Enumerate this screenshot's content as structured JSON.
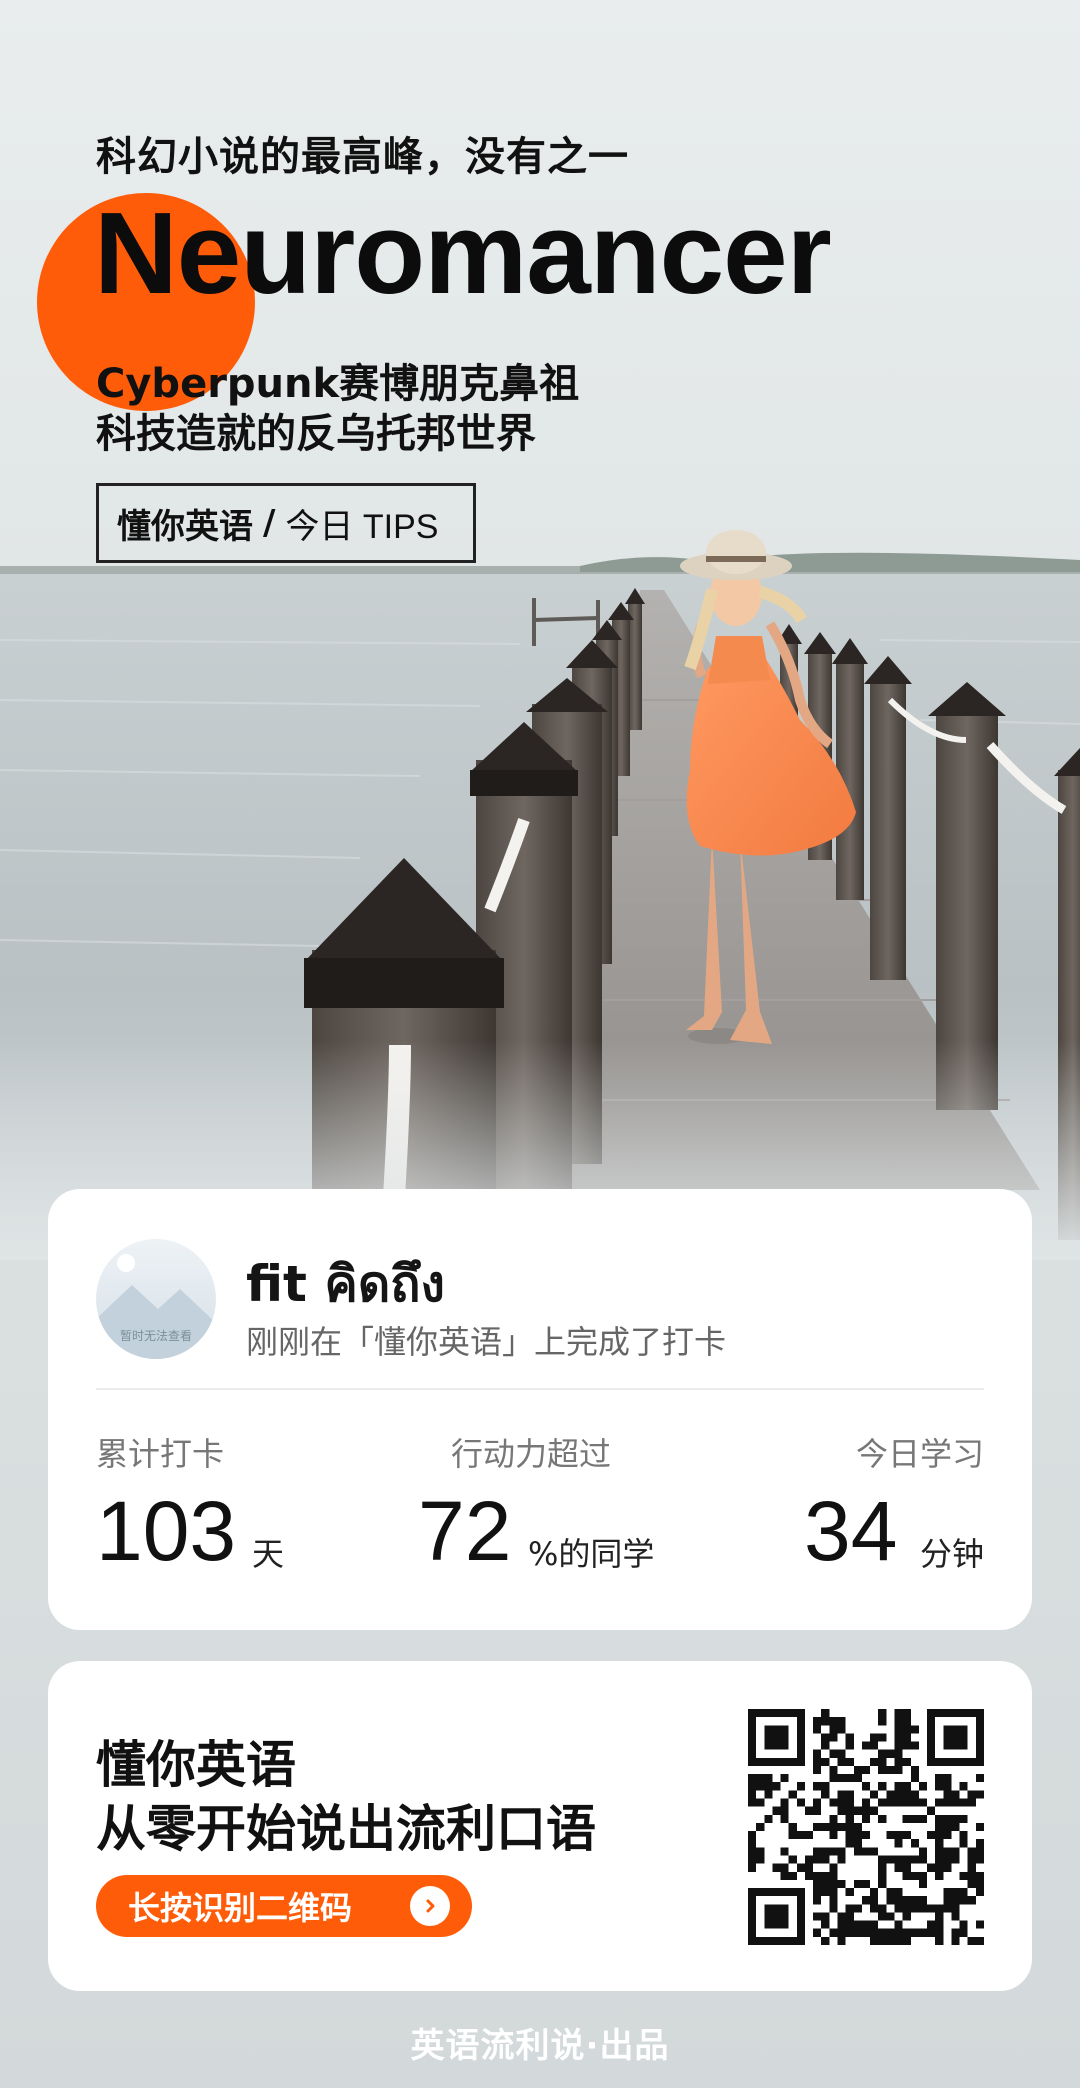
{
  "header": {
    "tagline": "科幻小说的最高峰，没有之一",
    "book_title": "Neuromancer",
    "subtitle_line1": "Cyberpunk赛博朋克鼻祖",
    "subtitle_line2": "科技造就的反乌托邦世界",
    "brand_name": "懂你英语",
    "brand_separator": "/",
    "brand_tips": "今日 TIPS"
  },
  "checkin_card": {
    "avatar_caption": "暂时无法查看",
    "username": "fit คิดถึง",
    "message": "刚刚在「懂你英语」上完成了打卡",
    "stats": [
      {
        "label": "累计打卡",
        "value": "103",
        "unit": "天"
      },
      {
        "label": "行动力超过",
        "value": "72",
        "unit": "%的同学"
      },
      {
        "label": "今日学习",
        "value": "34",
        "unit": "分钟"
      }
    ]
  },
  "promo_card": {
    "line1": "懂你英语",
    "line2": "从零开始说出流利口语",
    "button_label": "长按识别二维码",
    "button_icon": "chevron-right-icon",
    "qr_icon": "qr-code-icon"
  },
  "footer": {
    "text": "英语流利说·出品"
  },
  "colors": {
    "accent": "#ff5c0a",
    "background": "#e3e8e9",
    "card": "#ffffff",
    "text_primary": "#111111",
    "text_secondary": "#666666"
  }
}
